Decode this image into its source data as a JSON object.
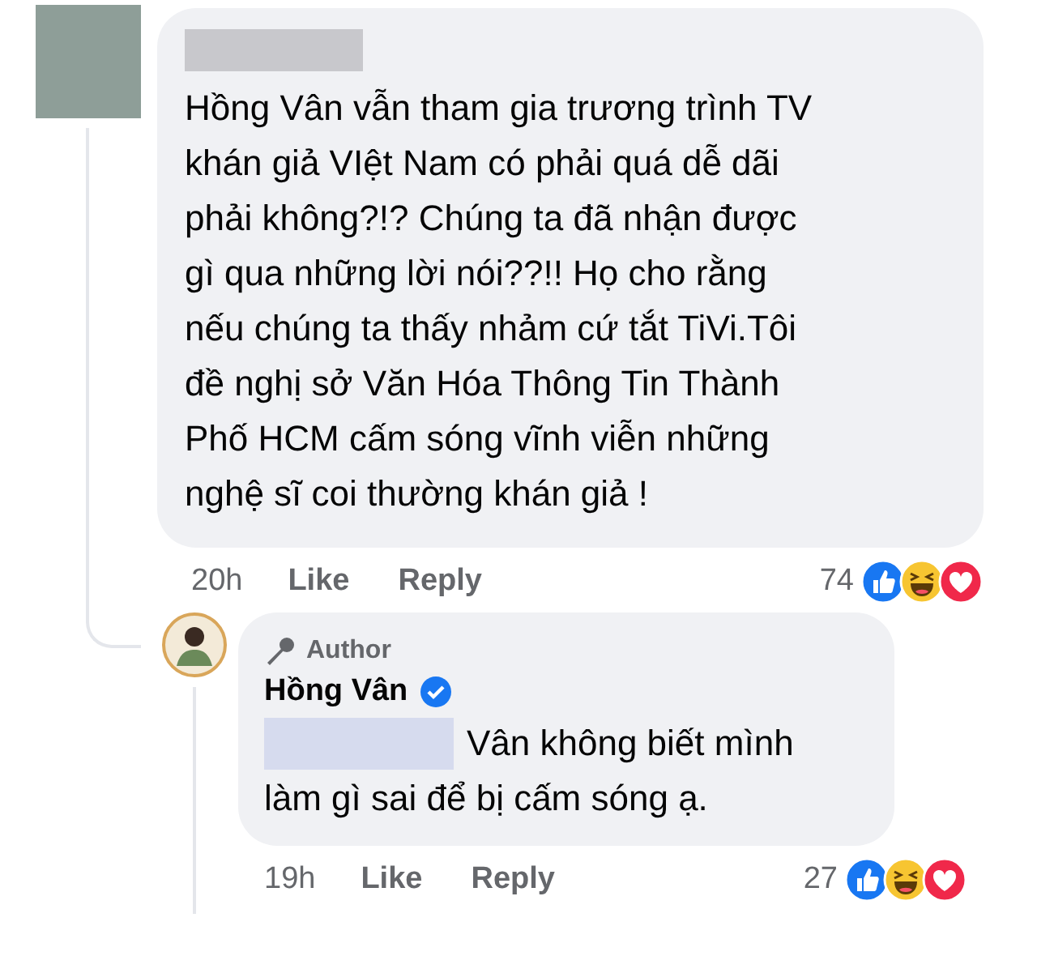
{
  "comment": {
    "text": "Hồng Vân vẫn tham gia trương trình TV\nkhán giả VIệt Nam có phải quá dễ dãi\nphải không?!? Chúng ta đã nhận được\ngì qua những lời nói??!! Họ cho rằng\nnếu chúng ta thấy nhảm cứ tắt TiVi.Tôi\nđề nghị sở Văn Hóa Thông Tin Thành\nPhố HCM cấm sóng vĩnh viễn những\nnghệ sĩ coi thường khán giả !",
    "time": "20h",
    "actions": [
      "Like",
      "Reply"
    ],
    "reaction_count": "74",
    "reactions": [
      {
        "kind": "like"
      },
      {
        "kind": "haha"
      },
      {
        "kind": "love"
      }
    ]
  },
  "reply": {
    "badge": "Author",
    "name": "Hồng Vân",
    "verified": true,
    "text_lines": [
      "Vân không biết mình",
      "làm gì sai để bị cấm sóng ạ."
    ],
    "time": "19h",
    "actions": [
      "Like",
      "Reply"
    ],
    "reaction_count": "27",
    "reactions": [
      {
        "kind": "like"
      },
      {
        "kind": "haha"
      },
      {
        "kind": "love"
      }
    ]
  }
}
